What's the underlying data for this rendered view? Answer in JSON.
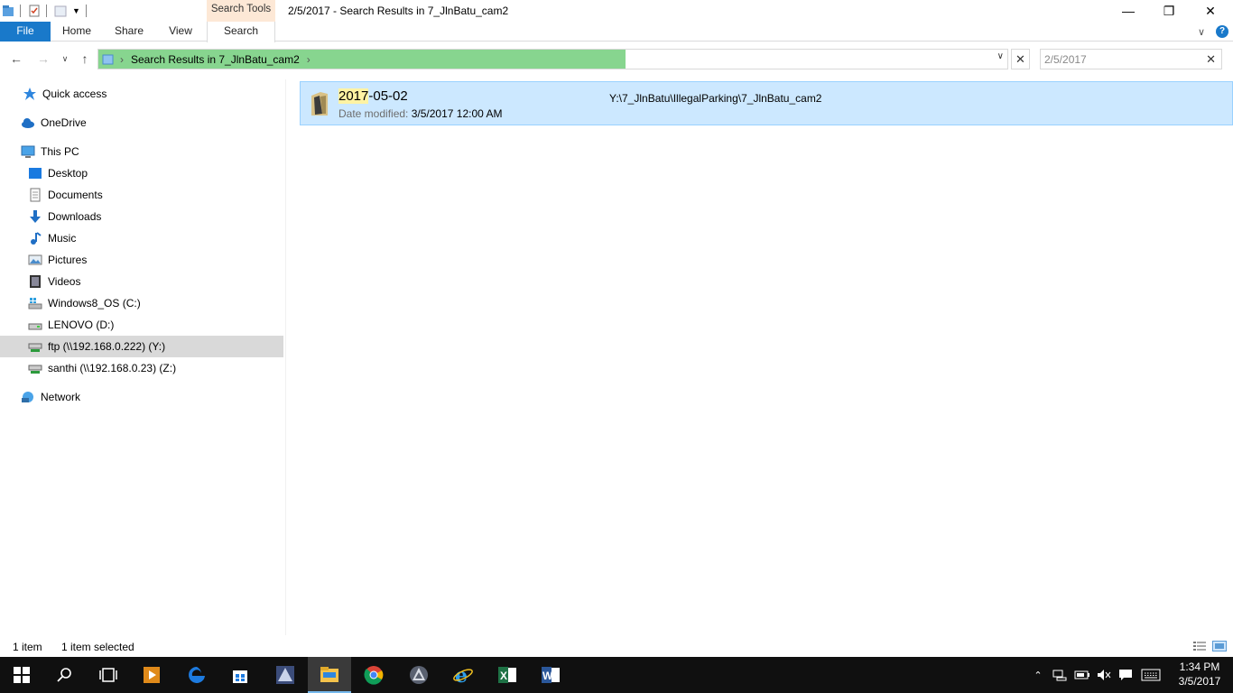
{
  "window": {
    "title": "2/5/2017 - Search Results in 7_JlnBatu_cam2",
    "context_tab_group": "Search Tools",
    "minimize_glyph": "—",
    "maximize_glyph": "❐",
    "close_glyph": "✕"
  },
  "ribbon": {
    "tabs": [
      {
        "label": "File"
      },
      {
        "label": "Home"
      },
      {
        "label": "Share"
      },
      {
        "label": "View"
      },
      {
        "label": "Search"
      }
    ],
    "expand_glyph": "∨",
    "help_glyph": "?"
  },
  "navigation": {
    "back_glyph": "←",
    "forward_glyph": "→",
    "recent_glyph": "∨",
    "up_glyph": "↑"
  },
  "address_bar": {
    "separator": "›",
    "location": "Search Results in 7_JlnBatu_cam2",
    "dropdown_glyph": "∨",
    "clear_glyph": "✕",
    "search_progress": 0.58
  },
  "search": {
    "value": "2/5/2017",
    "clear_glyph": "✕"
  },
  "sidebar": {
    "items": [
      {
        "label": "Quick access",
        "icon": "star-icon"
      },
      {
        "label": "OneDrive",
        "icon": "cloud-icon"
      },
      {
        "label": "This PC",
        "icon": "computer-icon"
      },
      {
        "label": "Desktop",
        "icon": "desktop-icon"
      },
      {
        "label": "Documents",
        "icon": "documents-icon"
      },
      {
        "label": "Downloads",
        "icon": "download-icon"
      },
      {
        "label": "Music",
        "icon": "music-icon"
      },
      {
        "label": "Pictures",
        "icon": "pictures-icon"
      },
      {
        "label": "Videos",
        "icon": "videos-icon"
      },
      {
        "label": "Windows8_OS (C:)",
        "icon": "windows-drive-icon"
      },
      {
        "label": "LENOVO (D:)",
        "icon": "drive-icon"
      },
      {
        "label": "ftp (\\\\192.168.0.222) (Y:)",
        "icon": "network-drive-icon",
        "selected": true
      },
      {
        "label": "santhi (\\\\192.168.0.23) (Z:)",
        "icon": "network-drive-icon"
      },
      {
        "label": "Network",
        "icon": "network-icon"
      }
    ]
  },
  "results": [
    {
      "name_highlight": "2017",
      "name_rest": "-05-02",
      "meta_label": "Date modified:",
      "meta_value": "3/5/2017 12:00 AM",
      "path": "Y:\\7_JlnBatu\\IllegalParking\\7_JlnBatu_cam2",
      "icon": "folder-icon"
    }
  ],
  "status": {
    "item_count": "1 item",
    "selected": "1 item selected"
  },
  "taskbar": {
    "apps": [
      "start-icon",
      "search-icon",
      "task-view-icon",
      "media-player-icon",
      "edge-icon",
      "store-icon",
      "app-icon",
      "file-explorer-icon",
      "chrome-icon",
      "app-icon-2",
      "internet-explorer-icon",
      "excel-icon",
      "word-icon"
    ],
    "clock_time": "1:34 PM",
    "clock_date": "3/5/2017"
  },
  "colors": {
    "accent": "#1979ca",
    "progress": "#87d58f",
    "selection": "#cce8ff",
    "search_tools": "#fde8d6",
    "taskbar": "#101010"
  }
}
